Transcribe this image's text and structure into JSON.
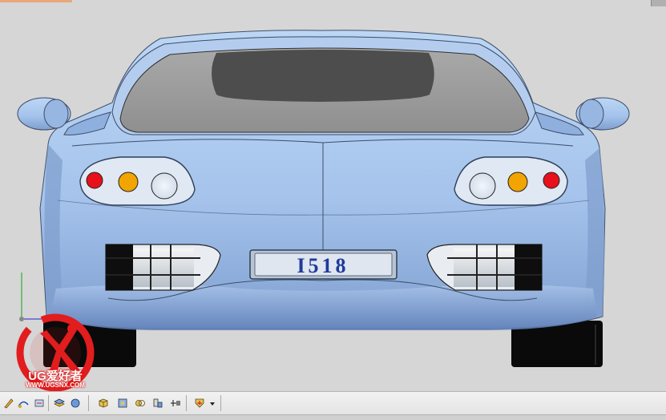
{
  "viewport": {
    "background": "#d6d6d6",
    "car_color": "#a9c8ef",
    "license_plate": "I518"
  },
  "watermark": {
    "brand_text": "UG爱好者",
    "url_text": "WWW.UGSNX.COM",
    "color": "#e21d1d"
  },
  "toolbar": {
    "buttons": [
      {
        "icon": "sketch-icon"
      },
      {
        "icon": "edit-curve-icon"
      },
      {
        "icon": "measure-icon"
      },
      {
        "icon": "layer-icon"
      },
      {
        "icon": "render-style-icon"
      },
      {
        "icon": "box-select-icon"
      },
      {
        "icon": "part-navigator-icon"
      },
      {
        "icon": "assembly-icon"
      },
      {
        "icon": "constraint-icon"
      },
      {
        "icon": "move-component-icon"
      },
      {
        "icon": "dropdown-arrow-icon"
      }
    ]
  }
}
